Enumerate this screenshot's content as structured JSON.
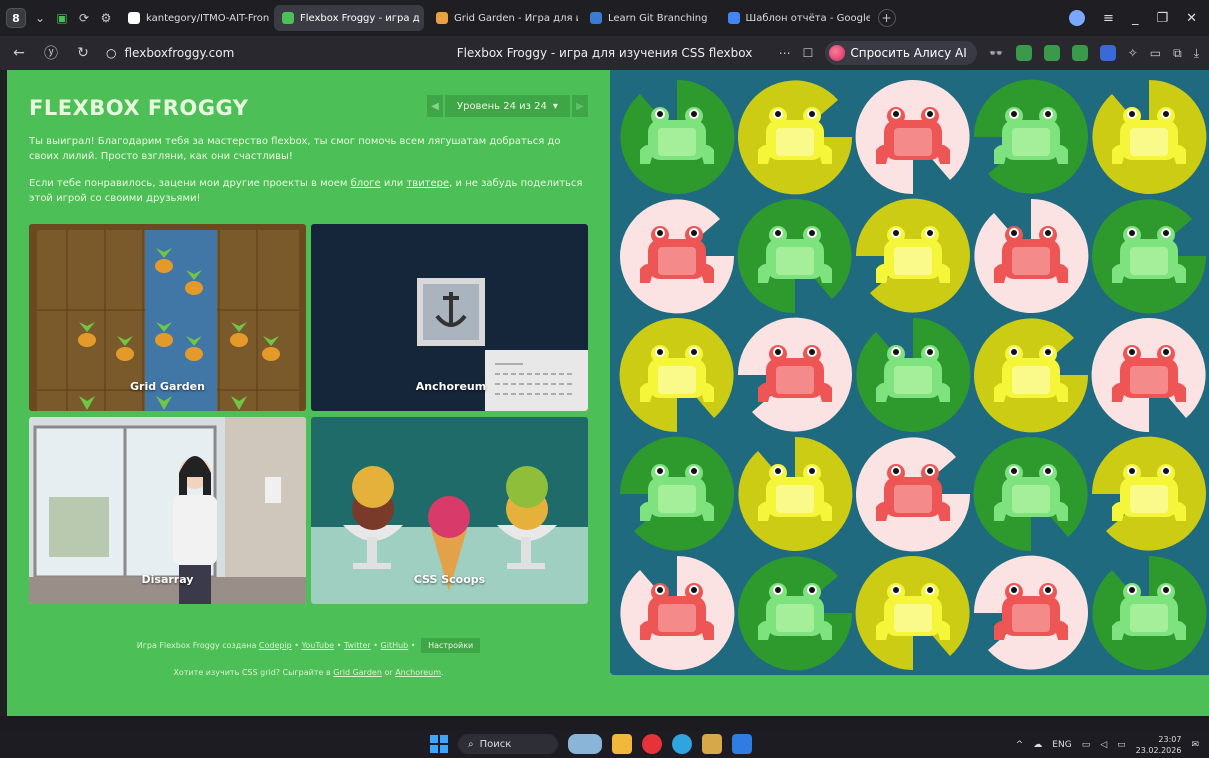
{
  "browser": {
    "workspace_badge": "8",
    "tabs": [
      {
        "label": "kantegory/ITMO-AIT-Fron",
        "active": false,
        "favicon_color": "#ffffff"
      },
      {
        "label": "Flexbox Froggy - игра д",
        "active": true,
        "favicon_color": "#4cbf56"
      },
      {
        "label": "Grid Garden - Игра для из",
        "active": false,
        "favicon_color": "#e8a040"
      },
      {
        "label": "Learn Git Branching",
        "active": false,
        "favicon_color": "#3a7bd5"
      },
      {
        "label": "Шаблон отчёта - Google",
        "active": false,
        "favicon_color": "#4285f4"
      }
    ],
    "url": "flexboxfroggy.com",
    "page_title": "Flexbox Froggy - игра для изучения CSS flexbox",
    "alice_label": "Спросить Алису AI"
  },
  "page": {
    "logo": "FLEXBOX FROGGY",
    "level_label": "Уровень 24 из 24",
    "level_dropdown": "▾",
    "win_text": "Ты выиграл! Благодарим тебя за мастерство flexbox, ты смог помочь всем лягушатам добраться до своих лилий. Просто взгляни, как они счастливы!",
    "share_text_1": "Если тебе понравилось, зацени мои другие проекты в моем ",
    "share_link_blog": "блоге",
    "share_text_2": " или ",
    "share_link_twitter": "твитере",
    "share_text_3": ", и не забудь поделиться этой игрой со своими друзьями!",
    "projects": [
      {
        "label": "Grid Garden"
      },
      {
        "label": "Anchoreum"
      },
      {
        "label": "Disarray"
      },
      {
        "label": "CSS Scoops"
      }
    ],
    "footer": {
      "created_by": "Игра Flexbox Froggy создана ",
      "codepip": "Codepip",
      "sep": " • ",
      "youtube": "YouTube",
      "twitter": "Twitter",
      "github": "GitHub",
      "settings": "Настройки",
      "grid_text": "Хотите изучить CSS grid? Сыграйте в ",
      "grid_garden": "Grid Garden",
      "or": " or ",
      "anchoreum": "Anchoreum",
      "dot": "."
    },
    "pond": {
      "rows": [
        [
          "green",
          "yellow",
          "red",
          "green",
          "yellow"
        ],
        [
          "red",
          "green",
          "yellow",
          "red",
          "green"
        ],
        [
          "yellow",
          "red",
          "green",
          "yellow",
          "red"
        ],
        [
          "green",
          "yellow",
          "red",
          "green",
          "yellow"
        ],
        [
          "red",
          "green",
          "yellow",
          "red",
          "green"
        ]
      ],
      "colors": {
        "green": {
          "pad": "#2e9a2e",
          "frog": "#7ee27e",
          "belly": "#a5ef9a"
        },
        "yellow": {
          "pad": "#cccc14",
          "frog": "#f5f53a",
          "belly": "#fafa8a"
        },
        "red": {
          "pad": "#fbe3e3",
          "frog": "#ee5555",
          "belly": "#f58a8a"
        }
      }
    }
  },
  "taskbar": {
    "search": "Поиск",
    "lang": "ENG",
    "time": "23:07",
    "date": "23.02.2026"
  }
}
